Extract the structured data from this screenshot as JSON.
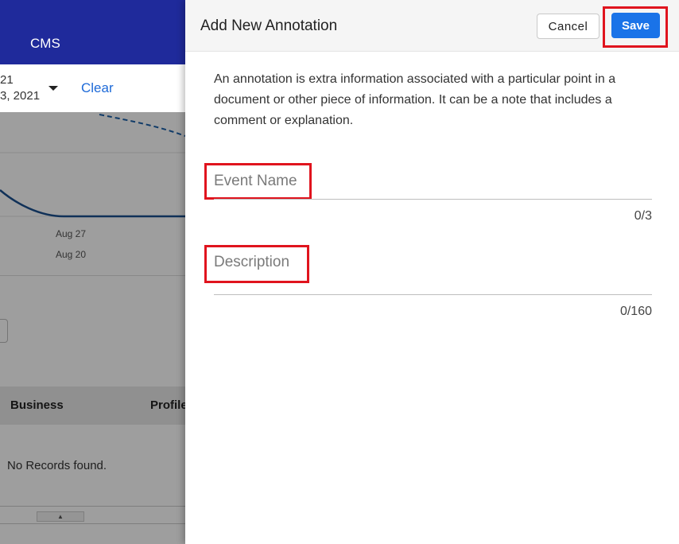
{
  "background": {
    "nav": {
      "label": "CMS"
    },
    "date_range": {
      "line1": "21",
      "line2": "3, 2021"
    },
    "clear_label": "Clear",
    "chart_ticks": [
      "Aug 27",
      "Aug 20"
    ],
    "table": {
      "columns": [
        "Business",
        "Profile"
      ],
      "empty_message": "No Records found."
    }
  },
  "panel": {
    "title": "Add New Annotation",
    "cancel_label": "Cancel",
    "save_label": "Save",
    "description": "An annotation is extra information associated with a particular point in a document or other piece of information. It can be a note that includes a comment or explanation.",
    "fields": {
      "event_name": {
        "placeholder": "Event Name",
        "value": "",
        "counter": "0/3"
      },
      "description": {
        "placeholder": "Description",
        "value": "",
        "counter": "0/160"
      }
    }
  },
  "colors": {
    "nav_background": "#1f2a9b",
    "primary_button": "#1a73e8",
    "highlight_box": "#e0141e",
    "link": "#1e6ad8"
  }
}
